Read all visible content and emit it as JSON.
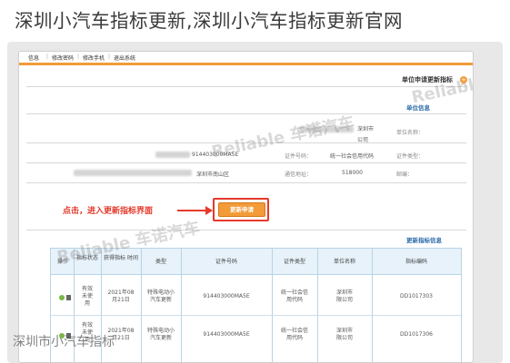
{
  "title": "深圳小汽车指标更新,深圳小汽车指标更新官网",
  "nav": {
    "items": [
      "信息",
      "修改密码",
      "修改手机",
      "退出系统"
    ]
  },
  "page_title": "单位申请更新指标",
  "unit_info": {
    "section_label": "单位信息",
    "name_label": "单位名称：",
    "name_value": "深圳市",
    "name_value2": "公司",
    "cert_type_label": "证件类型：",
    "cert_type_value": "统一社会信用代码",
    "cert_no_label": "证件号码：",
    "cert_no_value": "914403000MA5E",
    "addr_label": "通信地址：",
    "addr_value": "深圳市南山区",
    "zip_label": "邮编：",
    "zip_value": "518000"
  },
  "apply_button": "更新申请",
  "callout": "点击，进入更新指标界面",
  "quota_section_label": "更新指标信息",
  "table": {
    "headers": [
      "指标编码",
      "单位名称",
      "证件类型",
      "证件号码",
      "类型",
      "获得指标\n时间",
      "指标状态",
      "操作"
    ],
    "rows": [
      {
        "code": "DD1017303",
        "name": "深圳市\n限公司",
        "cert_type": "统一社会信\n用代码",
        "cert_no": "914403000MA5E",
        "type": "特殊电动小\n汽车更新",
        "date": "2021年08\n月21日",
        "status": "有效\n未使\n用"
      },
      {
        "code": "DD1017306",
        "name": "深圳市\n限公司",
        "cert_type": "统一社会信\n用代码",
        "cert_no": "914403000MA5E",
        "type": "特殊电动小\n汽车更新",
        "date": "2021年08\n月21日",
        "status": "有效\n未使\n用"
      }
    ]
  },
  "watermarks": [
    "Reliable 车诺汽车"
  ],
  "caption": "深圳市小汽车指标",
  "colors": {
    "accent": "#f29b38",
    "highlight": "#e53a2b",
    "link": "#2d6aa8"
  }
}
